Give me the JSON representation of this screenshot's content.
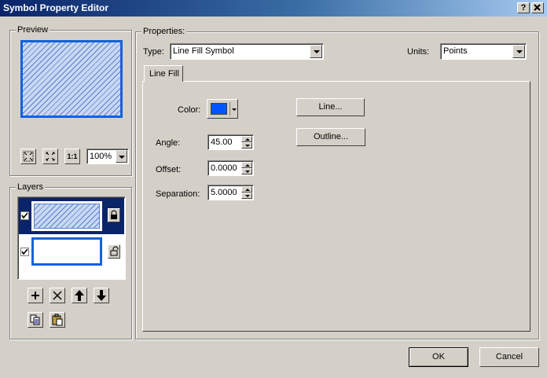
{
  "window": {
    "title": "Symbol Property Editor",
    "help_label": "?",
    "close_label": "X"
  },
  "preview": {
    "label": "Preview",
    "zoom_value": "100%",
    "actual_size_label": "1:1"
  },
  "layers": {
    "label": "Layers",
    "items": [
      {
        "checked": true,
        "locked": true,
        "selected": true
      },
      {
        "checked": true,
        "locked": false,
        "selected": false
      }
    ]
  },
  "properties": {
    "label": "Properties:",
    "type_label": "Type:",
    "type_value": "Line Fill Symbol",
    "units_label": "Units:",
    "units_value": "Points",
    "tab_label": "Line Fill",
    "color_label": "Color:",
    "color_value": "#0055ff",
    "angle_label": "Angle:",
    "angle_value": "45.00",
    "offset_label": "Offset:",
    "offset_value": "0.0000",
    "separation_label": "Separation:",
    "separation_value": "5.0000",
    "line_button": "Line...",
    "outline_button": "Outline..."
  },
  "footer": {
    "ok_label": "OK",
    "cancel_label": "Cancel"
  }
}
